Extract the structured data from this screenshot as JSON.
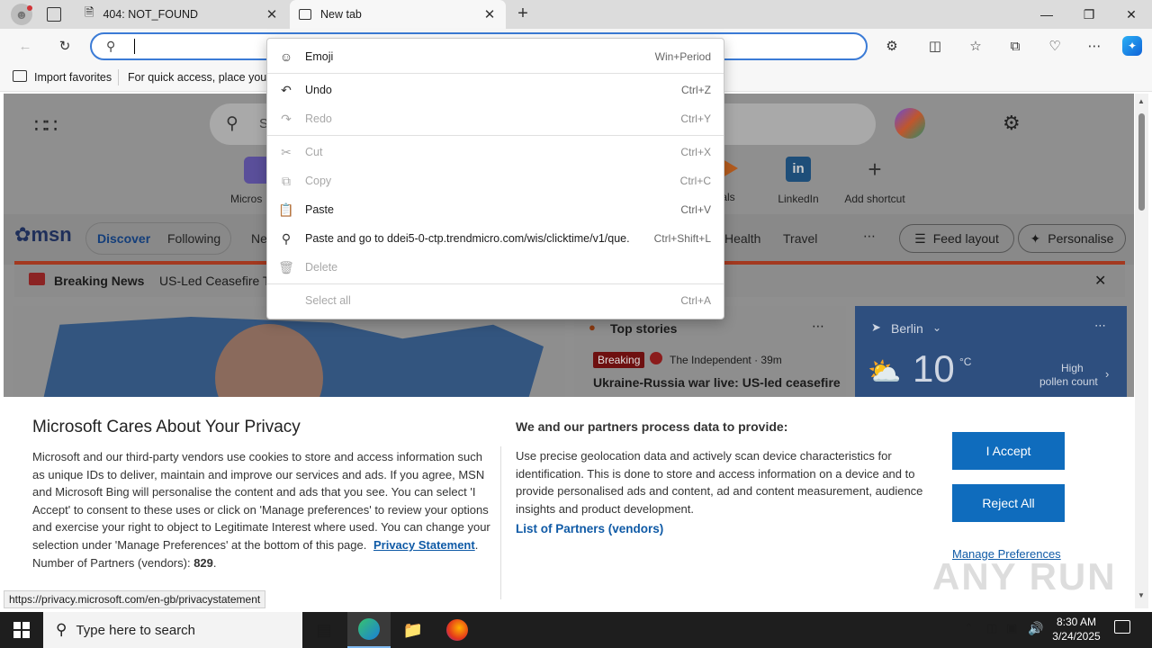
{
  "tabs": [
    {
      "label": "404: NOT_FOUND",
      "active": false
    },
    {
      "label": "New tab",
      "active": true
    }
  ],
  "window": {
    "minimize": "—",
    "restore": "❐",
    "close": "✕"
  },
  "favbar": {
    "import": "Import favorites",
    "hint": "For quick access, place your f"
  },
  "msn": {
    "brand": "msn",
    "search_placeholder": "S",
    "shortcuts": [
      {
        "label": "Micros"
      },
      {
        "label": "als"
      },
      {
        "label": "LinkedIn"
      },
      {
        "label": "Add shortcut"
      }
    ],
    "nav": [
      "Discover",
      "Following",
      "Ne",
      "Health",
      "Travel"
    ],
    "feed_layout": "Feed layout",
    "personalise": "Personalise",
    "breaking_label": "Breaking News",
    "breaking_text": "US-Led Ceasefire Ta",
    "top_stories": "Top stories",
    "breaking_badge": "Breaking",
    "source": "The Independent · 39m",
    "headline": "Ukraine-Russia war live: US-led ceasefire",
    "weather": {
      "city": "Berlin",
      "temp": "10",
      "unit": "°C",
      "pollen_level": "High",
      "pollen_label": "pollen count"
    }
  },
  "context_menu": [
    {
      "label": "Emoji",
      "shortcut": "Win+Period",
      "icon": "emoji-icon",
      "disabled": false
    },
    {
      "label": "Undo",
      "shortcut": "Ctrl+Z",
      "icon": "undo-icon",
      "disabled": false
    },
    {
      "label": "Redo",
      "shortcut": "Ctrl+Y",
      "icon": "redo-icon",
      "disabled": true
    },
    {
      "label": "Cut",
      "shortcut": "Ctrl+X",
      "icon": "cut-icon",
      "disabled": true
    },
    {
      "label": "Copy",
      "shortcut": "Ctrl+C",
      "icon": "copy-icon",
      "disabled": true
    },
    {
      "label": "Paste",
      "shortcut": "Ctrl+V",
      "icon": "paste-icon",
      "disabled": false
    },
    {
      "label": "Paste and go to ddei5-0-ctp.trendmicro.com/wis/clicktime/v1/que...",
      "shortcut": "Ctrl+Shift+L",
      "icon": "paste-go-icon",
      "disabled": false
    },
    {
      "label": "Delete",
      "shortcut": "",
      "icon": "delete-icon",
      "disabled": true
    },
    {
      "label": "Select all",
      "shortcut": "Ctrl+A",
      "icon": "",
      "disabled": true
    }
  ],
  "privacy": {
    "title": "Microsoft Cares About Your Privacy",
    "body": "Microsoft and our third-party vendors use cookies to store and access information such as unique IDs to deliver, maintain and improve our services and ads. If you agree, MSN and Microsoft Bing will personalise the content and ads that you see. You can select 'I Accept' to consent to these uses or click on 'Manage preferences' to review your options and exercise your right to object to Legitimate Interest where used.  You can change your selection under 'Manage Preferences' at the bottom of this page.",
    "privacy_link": "Privacy Statement",
    "partners_prefix": "Number of Partners (vendors):",
    "partners_count": "829",
    "right_title": "We and our partners process data to provide:",
    "right_body": "Use precise geolocation data and actively scan device characteristics for identification. This is done to store and access information on a device and to provide personalised ads and content, ad and content measurement, audience insights and product development.",
    "partners_link": "List of Partners (vendors)",
    "accept": "I Accept",
    "reject": "Reject All",
    "manage": "Manage Preferences"
  },
  "status_url": "https://privacy.microsoft.com/en-gb/privacystatement",
  "taskbar": {
    "search": "Type here to search",
    "time": "8:30 AM",
    "date": "3/24/2025"
  },
  "watermark": "ANY RUN",
  "colors": {
    "accent": "#0f6cbd",
    "breaking": "#c41b1b"
  }
}
